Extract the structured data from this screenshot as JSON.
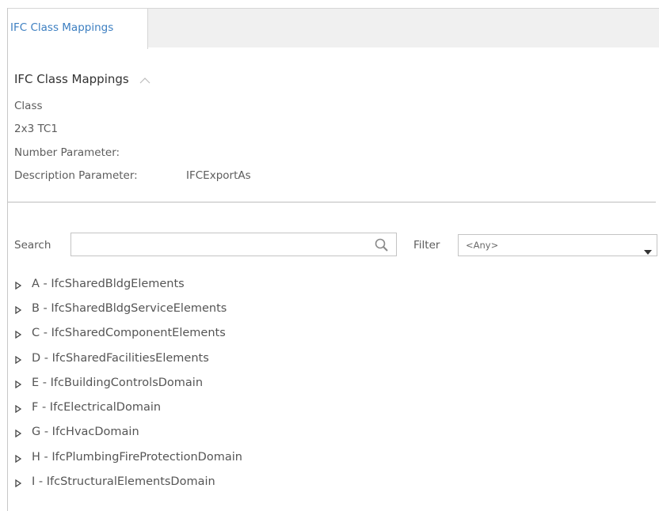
{
  "tabs": [
    {
      "label": "IFC Class Mappings",
      "active": true
    }
  ],
  "section": {
    "title": "IFC Class Mappings",
    "collapse_icon": "chevron-up-icon"
  },
  "properties": {
    "class_label": "Class",
    "class_value": "2x3 TC1",
    "number_parameter_label": "Number Parameter:",
    "number_parameter_value": "",
    "description_parameter_label": "Description Parameter:",
    "description_parameter_value": "IFCExportAs"
  },
  "search": {
    "label": "Search",
    "value": "",
    "placeholder": "",
    "icon": "search-icon"
  },
  "filter": {
    "label": "Filter",
    "selected": "<Any>",
    "icon": "caret-down-icon"
  },
  "tree": {
    "toggle_icon": "caret-right-icon",
    "items": [
      {
        "label": "A - IfcSharedBldgElements"
      },
      {
        "label": "B - IfcSharedBldgServiceElements"
      },
      {
        "label": "C - IfcSharedComponentElements"
      },
      {
        "label": "D - IfcSharedFacilitiesElements"
      },
      {
        "label": "E - IfcBuildingControlsDomain"
      },
      {
        "label": "F - IfcElectricalDomain"
      },
      {
        "label": "G - IfcHvacDomain"
      },
      {
        "label": "H - IfcPlumbingFireProtectionDomain"
      },
      {
        "label": "I - IfcStructuralElementsDomain"
      }
    ]
  },
  "colors": {
    "tab_text": "#3d7fc1",
    "tabbar_bg": "#f0f0f0",
    "divider": "#bdbdbd",
    "text": "#555555"
  }
}
